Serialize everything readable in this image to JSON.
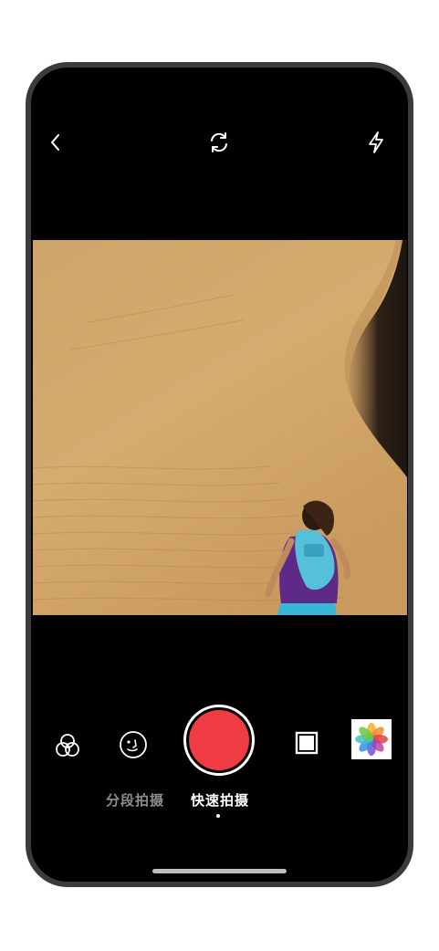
{
  "camera": {
    "top_bar": {
      "back_icon": "chevron-left",
      "flip_icon": "camera-flip",
      "flash_icon": "lightning-bolt"
    },
    "modes": [
      {
        "label": "分段拍摄",
        "active": false
      },
      {
        "label": "快速拍摄",
        "active": true
      }
    ],
    "controls": {
      "filter_icon": "filter-circles",
      "beauty_icon": "smiley-face",
      "shutter_color": "#ef3b42",
      "stop_icon": "square",
      "gallery_icon": "photos-flower"
    }
  }
}
